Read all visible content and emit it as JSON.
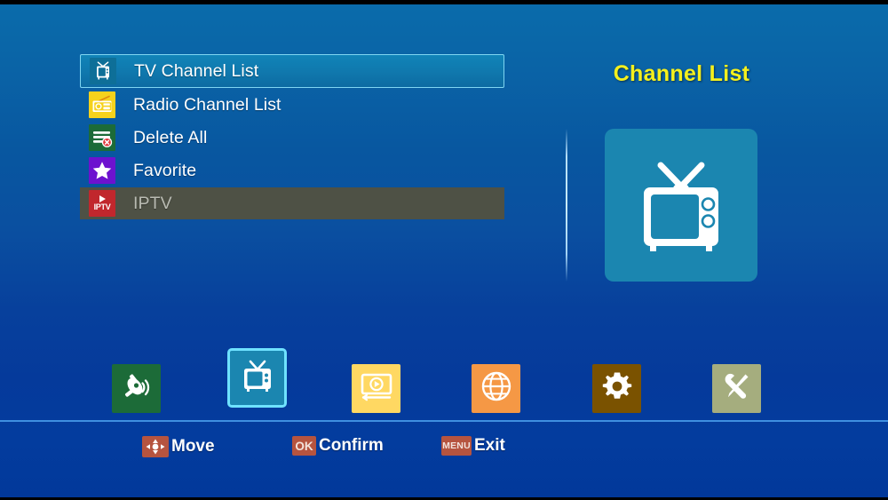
{
  "screen": {
    "background_top": "#0a6cab",
    "background_bottom": "#02389a"
  },
  "menu": {
    "items": [
      {
        "label": "TV Channel List",
        "icon": "tv-icon",
        "state": "selected"
      },
      {
        "label": "Radio Channel List",
        "icon": "radio-icon",
        "state": "normal"
      },
      {
        "label": "Delete All",
        "icon": "delete-icon",
        "state": "normal"
      },
      {
        "label": "Favorite",
        "icon": "star-icon",
        "state": "normal"
      },
      {
        "label": "IPTV",
        "icon": "iptv-icon",
        "state": "disabled"
      }
    ]
  },
  "panel": {
    "title": "Channel List",
    "title_color": "#f5f01d",
    "icon": "tv-icon",
    "icon_background": "#1b86b0"
  },
  "navbar": {
    "items": [
      {
        "name": "installation",
        "icon": "satellite-dish-icon",
        "color": "#1c6b38",
        "active": false
      },
      {
        "name": "channel",
        "icon": "tv-icon",
        "color": "#1b86b0",
        "active": true
      },
      {
        "name": "media",
        "icon": "media-player-icon",
        "color": "#ffd862",
        "active": false
      },
      {
        "name": "network",
        "icon": "globe-icon",
        "color": "#f59845",
        "active": false
      },
      {
        "name": "settings",
        "icon": "gear-icon",
        "color": "#7a5200",
        "active": false
      },
      {
        "name": "tools",
        "icon": "tools-icon",
        "color": "#a5ad7e",
        "active": false
      }
    ]
  },
  "hints": [
    {
      "key": "dpad",
      "key_label": "",
      "label": "Move"
    },
    {
      "key": "ok",
      "key_label": "OK",
      "label": "Confirm"
    },
    {
      "key": "menu",
      "key_label": "MENU",
      "label": "Exit"
    }
  ],
  "hint_key_color": "#b6543f"
}
